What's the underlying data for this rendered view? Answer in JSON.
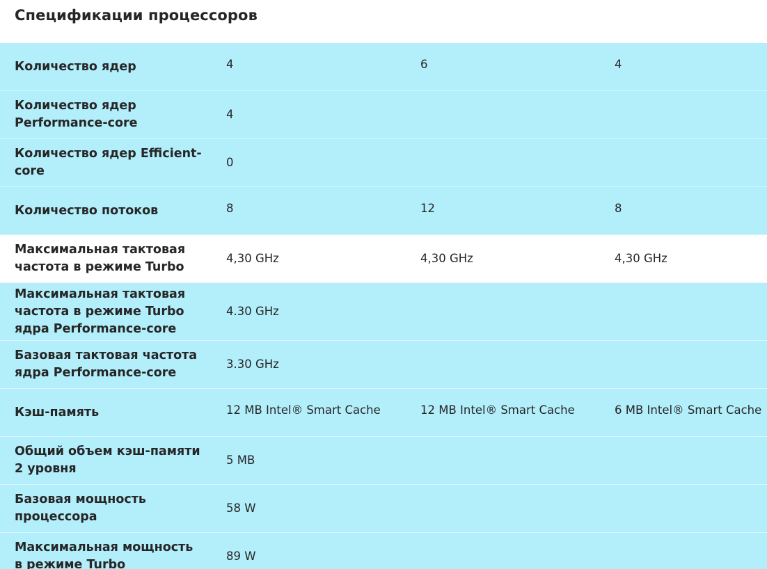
{
  "page": {
    "title": "Спецификации процессоров"
  },
  "rows": [
    {
      "label": "Количество ядер",
      "c1": "4",
      "c2": "6",
      "c3": "4"
    },
    {
      "label": "Количество ядер Performance-core",
      "c1": "4",
      "c2": "",
      "c3": ""
    },
    {
      "label": "Количество ядер Efficient-core",
      "c1": "0",
      "c2": "",
      "c3": ""
    },
    {
      "label": "Количество потоков",
      "c1": "8",
      "c2": "12",
      "c3": "8"
    },
    {
      "label": "Максимальная тактовая частота в режиме Turbo",
      "c1": "4,30 GHz",
      "c2": "4,30 GHz",
      "c3": "4,30 GHz"
    },
    {
      "label": "Максимальная тактовая частота в режиме Turbo ядра Performance-core",
      "c1": "4.30 GHz",
      "c2": "",
      "c3": ""
    },
    {
      "label": "Базовая тактовая частота ядра Performance-core",
      "c1": "3.30 GHz",
      "c2": "",
      "c3": ""
    },
    {
      "label": "Кэш-память",
      "c1": "12 MB Intel® Smart Cache",
      "c2": "12 MB Intel® Smart Cache",
      "c3": "6 MB Intel® Smart Cache"
    },
    {
      "label": "Общий объем кэш-памяти 2 уровня",
      "c1": "5 MB",
      "c2": "",
      "c3": ""
    },
    {
      "label": "Базовая мощность процессора",
      "c1": "58 W",
      "c2": "",
      "c3": ""
    },
    {
      "label": "Максимальная мощность в режиме Turbo",
      "c1": "89 W",
      "c2": "",
      "c3": ""
    }
  ]
}
